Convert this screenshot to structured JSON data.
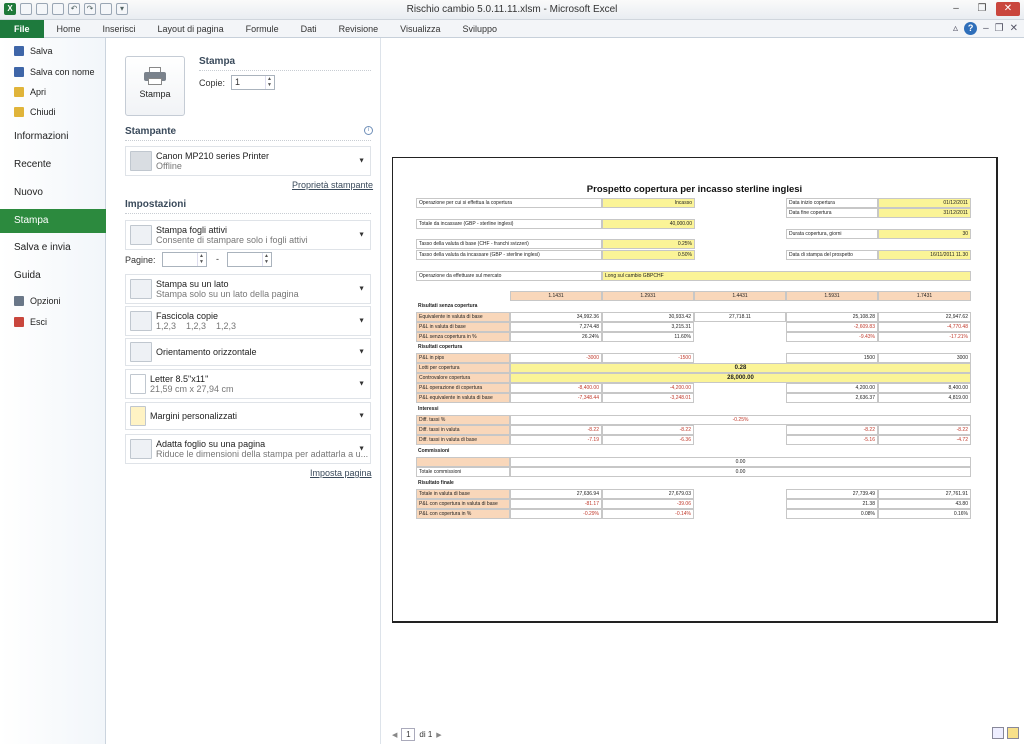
{
  "window": {
    "title": "Rischio cambio 5.0.11.11.xlsm  -  Microsoft Excel"
  },
  "tabs": [
    "File",
    "Home",
    "Inserisci",
    "Layout di pagina",
    "Formule",
    "Dati",
    "Revisione",
    "Visualizza",
    "Sviluppo"
  ],
  "sidebar": {
    "small": [
      {
        "label": "Salva",
        "color": "#3f66a8"
      },
      {
        "label": "Salva con nome",
        "color": "#3f66a8"
      },
      {
        "label": "Apri",
        "color": "#e0b43a"
      },
      {
        "label": "Chiudi",
        "color": "#e0b43a"
      }
    ],
    "big": [
      "Informazioni",
      "Recente",
      "Nuovo"
    ],
    "selected": "Stampa",
    "big2": [
      "Salva e invia",
      "Guida"
    ],
    "small2": [
      {
        "label": "Opzioni",
        "color": "#6a7788"
      },
      {
        "label": "Esci",
        "color": "#c9463d"
      }
    ]
  },
  "print": {
    "header": "Stampa",
    "button_label": "Stampa",
    "copies_label": "Copie:",
    "copies_value": "1",
    "printer_header": "Stampante",
    "printer_name": "Canon MP210 series Printer",
    "printer_status": "Offline",
    "printer_props": "Proprietà stampante",
    "settings_header": "Impostazioni",
    "pages_label": "Pagine:",
    "pages_sep": "-",
    "setup_link": "Imposta pagina",
    "options": [
      {
        "t1": "Stampa fogli attivi",
        "t2": "Consente di stampare solo i fogli attivi"
      },
      {
        "t1": "Stampa su un lato",
        "t2": "Stampa solo su un lato della pagina"
      },
      {
        "t1": "Fascicola copie",
        "t2": "1,2,3    1,2,3    1,2,3"
      },
      {
        "t1": "Orientamento orizzontale",
        "t2": ""
      },
      {
        "t1": "Letter 8.5\"x11\"",
        "t2": "21,59 cm x 27,94 cm"
      },
      {
        "t1": "Margini personalizzati",
        "t2": ""
      },
      {
        "t1": "Adatta foglio su una pagina",
        "t2": "Riduce le dimensioni della stampa per adattarla a u..."
      }
    ]
  },
  "report": {
    "title": "Prospetto copertura per incasso sterline inglesi",
    "op_label": "Operazione per cui si effettua la copertura",
    "op_value": "Incasso",
    "total_label": "Totale da incassare (GBP - sterline inglesi)",
    "total_value": "40,000.00",
    "rate_base_label": "Tasso della valuta di base (CHF - franchi svizzeri)",
    "rate_base_value": "0.25%",
    "rate_inc_label": "Tasso della valuta da incassare (GBP - sterline inglesi)",
    "rate_inc_value": "0.50%",
    "market_label": "Operazione da effettuare sul mercato",
    "market_value": "Long sul cambio GBPCHF",
    "start_label": "Data inizio copertura",
    "start_value": "01/12/2011",
    "end_label": "Data fine copertura",
    "end_value": "31/12/2011",
    "dur_label": "Durata copertura, giorni",
    "dur_value": "30",
    "print_label": "Data di stampa del prospetto",
    "print_value": "16/11/2011 11.30",
    "rates": [
      "1.1431",
      "1.2931",
      "1.4431",
      "1.5931",
      "1.7431"
    ],
    "s1": "Risultati senza copertura",
    "s1_rows": [
      {
        "label": "Equivalente in valuta di base",
        "vals": [
          "34,992.36",
          "30,933.42",
          "27,718.11",
          "25,108.28",
          "22,947.62"
        ]
      },
      {
        "label": "P&L in valuta di base",
        "vals": [
          "7,274.48",
          "3,215.31",
          "",
          "-2,609.83",
          "-4,770.48"
        ]
      },
      {
        "label": "P&L senza copertura in %",
        "vals": [
          "26.24%",
          "11.60%",
          "",
          "-9.43%",
          "-17.21%"
        ]
      }
    ],
    "s2": "Risultati copertura",
    "pips_label": "P&L in pips",
    "pips_vals": [
      "-3000",
      "-1500",
      "",
      "1500",
      "3000"
    ],
    "lots_label": "Lotti per copertura",
    "lots_value": "0.28",
    "ctrv_label": "Controvalore copertura",
    "ctrv_value": "28,000.00",
    "pl_op_label": "P&L operazione di copertura",
    "pl_op_vals": [
      "-8,400.00",
      "-4,200.00",
      "",
      "4,200.00",
      "8,400.00"
    ],
    "pl_eq_label": "P&L equivalente in valuta di base",
    "pl_eq_vals": [
      "-7,348.44",
      "-3,248.01",
      "",
      "2,636.37",
      "4,819.00"
    ],
    "s3": "Interessi",
    "diff_label": "Diff. tassi %",
    "diff_value": "-0.25%",
    "diff_val_label": "Diff. tassi in valuta",
    "diff_val_vals": [
      "-8.22",
      "-8.22",
      "",
      "-8.22",
      "-8.22"
    ],
    "diff_base_label": "Diff. tassi in valuta di base",
    "diff_base_vals": [
      "-7.19",
      "-6.36",
      "",
      "-5.16",
      "-4.72"
    ],
    "s4": "Commissioni",
    "comm_value": "0.00",
    "comm_total_label": "Totale commissioni",
    "comm_total_value": "0.00",
    "s5": "Risultato finale",
    "fin_rows": [
      {
        "label": "Totale in valuta di base",
        "vals": [
          "27,636.94",
          "27,679.03",
          "",
          "27,739.49",
          "27,761.91"
        ]
      },
      {
        "label": "P&L con copertura in valuta di base",
        "vals": [
          "-81.17",
          "-39.06",
          "",
          "21.38",
          "43.80"
        ]
      },
      {
        "label": "P&L con copertura in %",
        "vals": [
          "-0.29%",
          "-0.14%",
          "",
          "0.08%",
          "0.16%"
        ]
      }
    ]
  },
  "pager": {
    "current": "1",
    "total": "di 1"
  }
}
